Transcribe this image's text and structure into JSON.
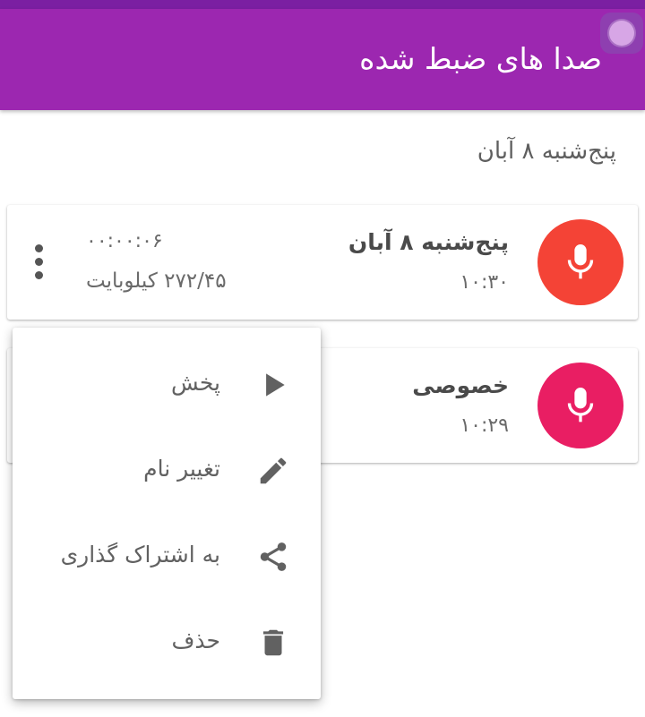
{
  "app_bar": {
    "title": "صدا های ضبط شده"
  },
  "section": {
    "header": "پنج‌شنبه ۸ آبان"
  },
  "recordings": [
    {
      "title": "پنج‌شنبه ۸ آبان",
      "time": "۱۰:۳۰",
      "duration": "۰۰:۰۰:۰۶",
      "size": "۲۷۲/۴۵ کیلوبایت",
      "icon": "mic-icon",
      "color": "#f44336"
    },
    {
      "title": "خصوصی",
      "time": "۱۰:۲۹",
      "icon": "mic-icon",
      "color": "#e91e63"
    }
  ],
  "popup_menu": {
    "items": [
      {
        "label": "پخش",
        "icon": "play-icon"
      },
      {
        "label": "تغییر نام",
        "icon": "pencil-icon"
      },
      {
        "label": "به اشتراک گذاری",
        "icon": "share-icon"
      },
      {
        "label": "حذف",
        "icon": "trash-icon"
      }
    ]
  },
  "colors": {
    "app_bar": "#9c27b0",
    "status_bar": "#7b1fa2"
  }
}
